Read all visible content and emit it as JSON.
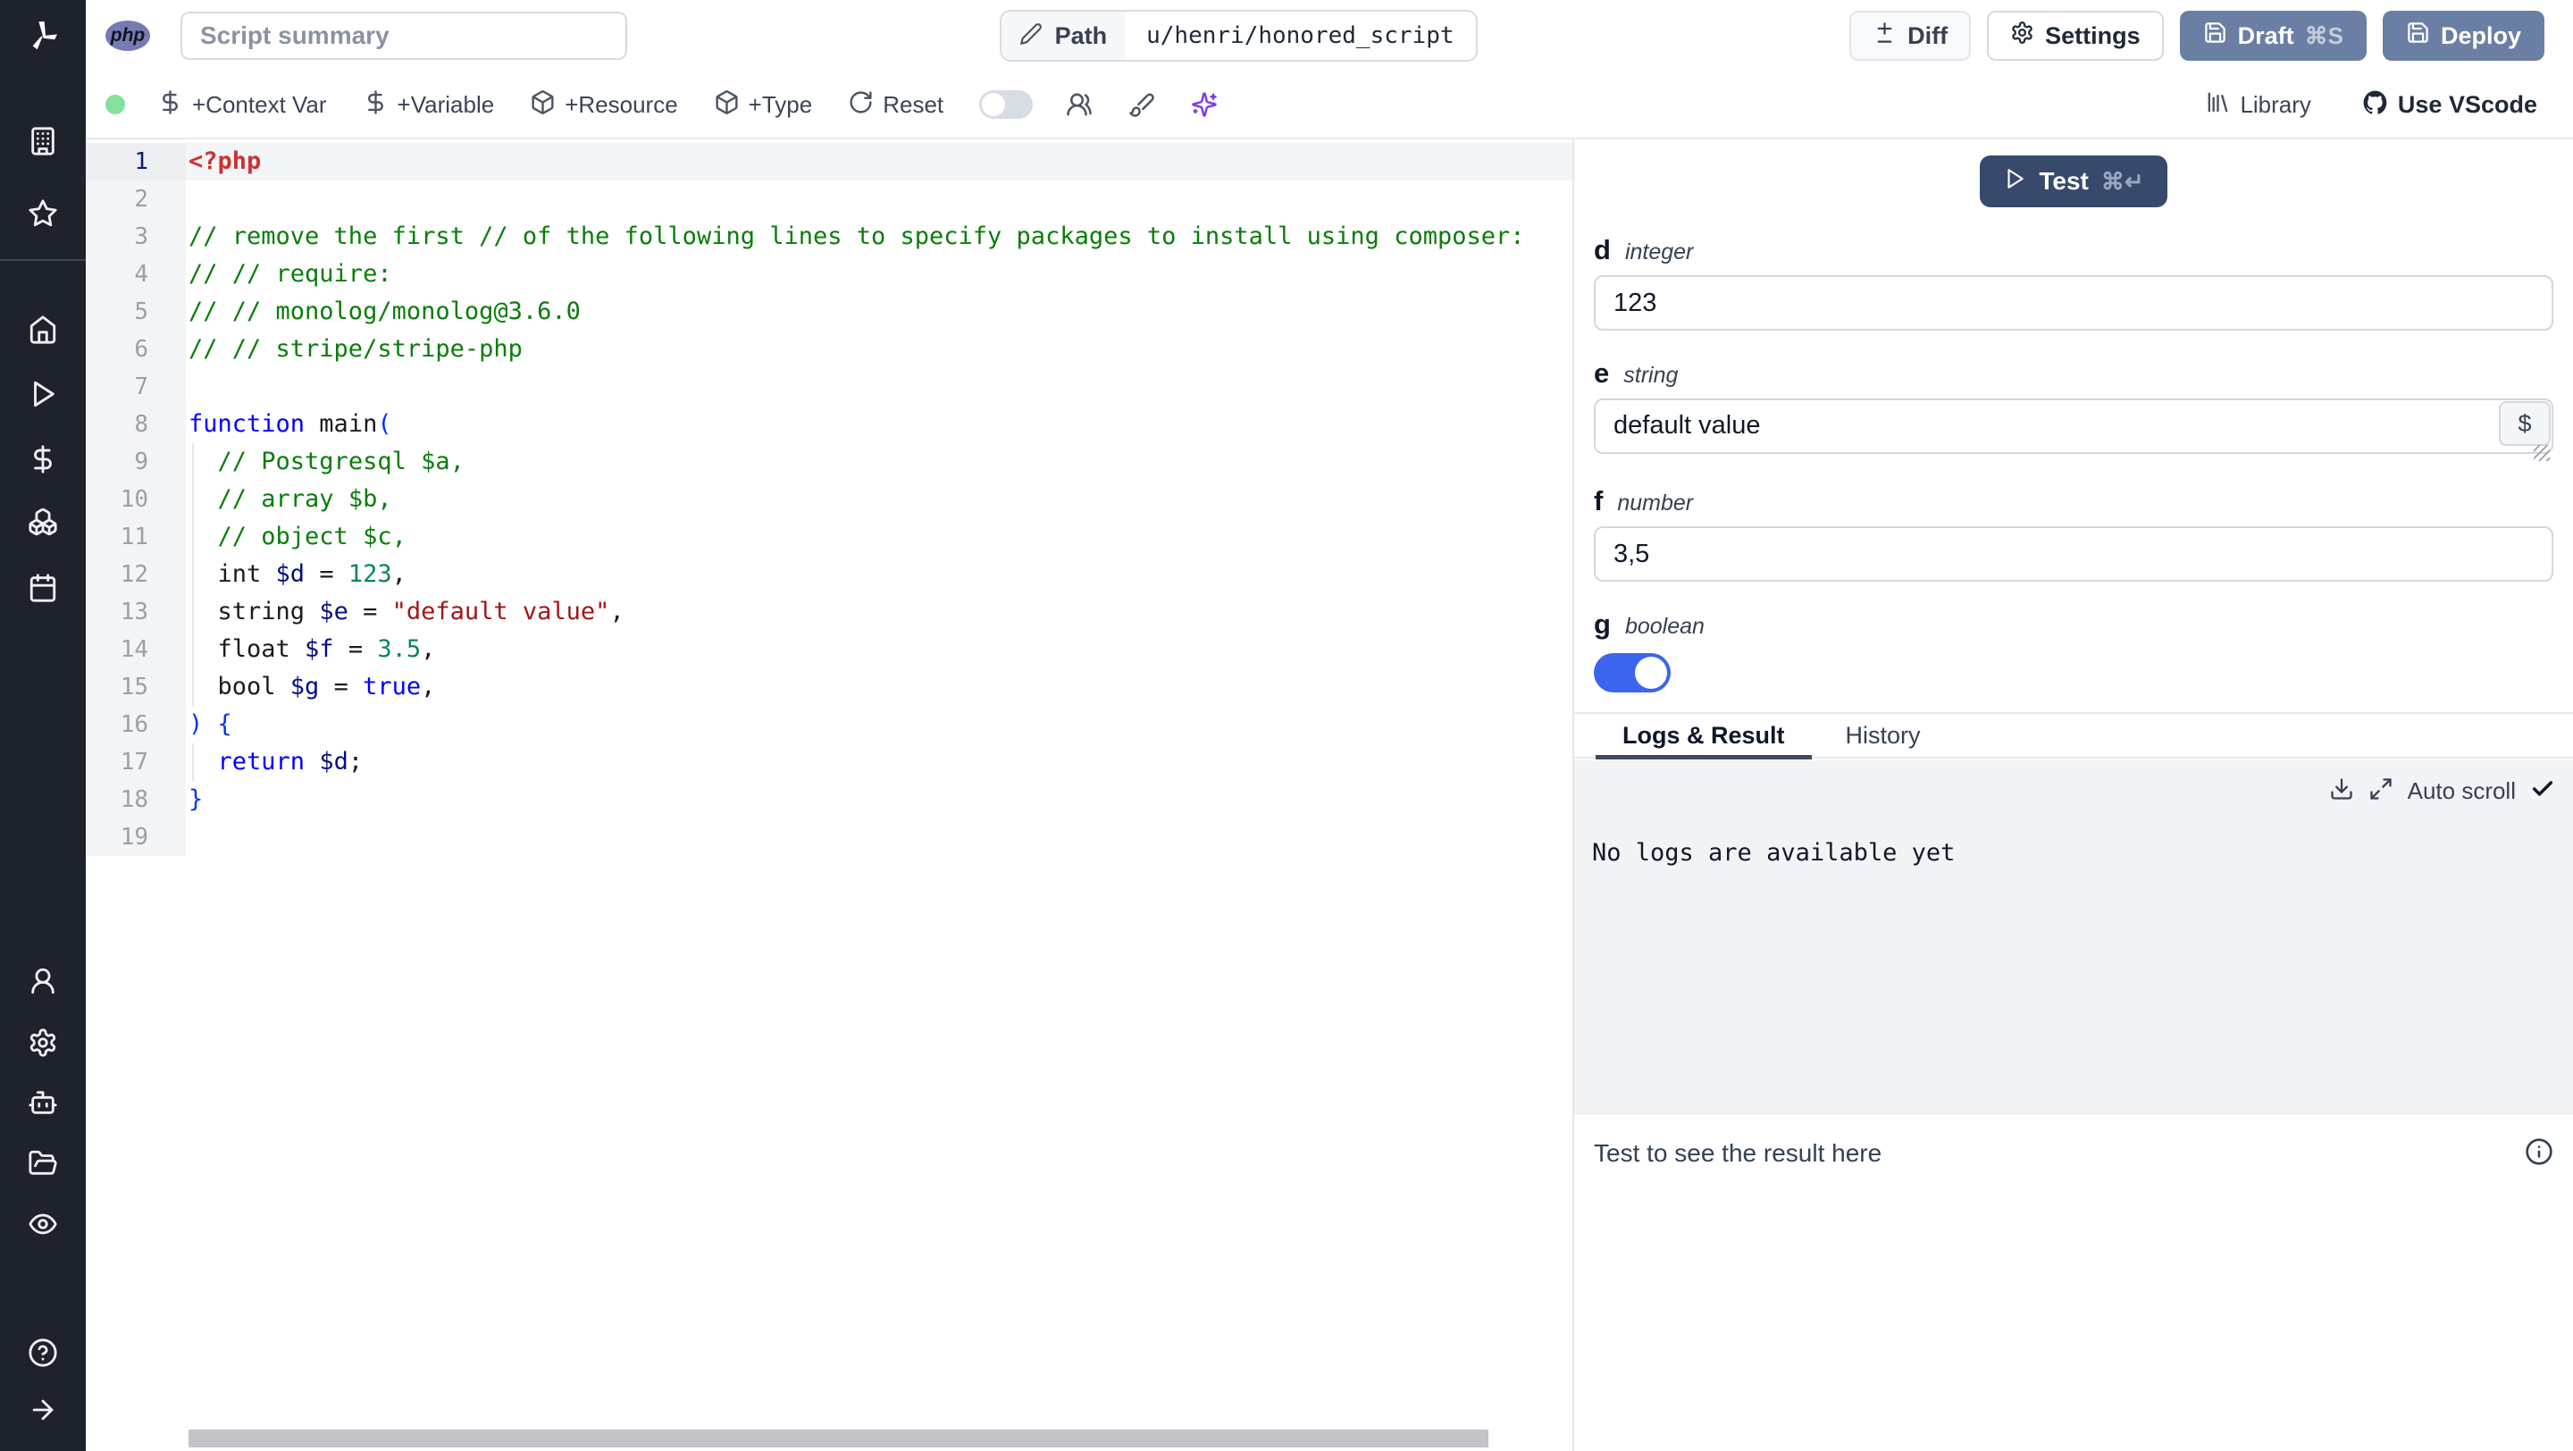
{
  "colors": {
    "sidebar_bg": "#1d222d",
    "primary_button": "#6b7fa4",
    "test_button": "#384a6b",
    "toggle_on": "#3c64ee",
    "php_badge": "#777bb3",
    "green_status_dot": "#84e19c",
    "sparkles_accent": "#7c3aed",
    "code_comment": "#0a7d0a",
    "code_keyword": "#0000ff",
    "code_variable": "#001080",
    "code_number": "#098658",
    "code_string": "#a31515",
    "code_tag": "#cd3131"
  },
  "header": {
    "lang_badge": "php",
    "summary_placeholder": "Script summary",
    "path_label": "Path",
    "path_value": "u/henri/honored_script",
    "diff_label": "Diff",
    "settings_label": "Settings",
    "draft_label": "Draft",
    "draft_shortcut": "⌘S",
    "deploy_label": "Deploy"
  },
  "toolbar": {
    "add_context_var": "+Context Var",
    "add_variable": "+Variable",
    "add_resource": "+Resource",
    "add_type": "+Type",
    "reset": "Reset",
    "library": "Library",
    "use_vscode": "Use VScode"
  },
  "editor": {
    "language": "php",
    "lines": [
      {
        "n": 1,
        "current": true,
        "toks": [
          [
            "tag",
            "<?php"
          ]
        ]
      },
      {
        "n": 2,
        "toks": []
      },
      {
        "n": 3,
        "toks": [
          [
            "com",
            "// remove the first // of the following lines to specify packages to install using composer:"
          ]
        ]
      },
      {
        "n": 4,
        "toks": [
          [
            "com",
            "// // require:"
          ]
        ]
      },
      {
        "n": 5,
        "toks": [
          [
            "com",
            "// // monolog/monolog@3.6.0"
          ]
        ]
      },
      {
        "n": 6,
        "toks": [
          [
            "com",
            "// // stripe/stripe-php"
          ]
        ]
      },
      {
        "n": 7,
        "toks": []
      },
      {
        "n": 8,
        "toks": [
          [
            "kw",
            "function"
          ],
          [
            "pl",
            " main"
          ],
          [
            "br",
            "("
          ]
        ]
      },
      {
        "n": 9,
        "toks": [
          [
            "pl",
            "  "
          ],
          [
            "com",
            "// Postgresql $a,"
          ]
        ]
      },
      {
        "n": 10,
        "toks": [
          [
            "pl",
            "  "
          ],
          [
            "com",
            "// array $b,"
          ]
        ]
      },
      {
        "n": 11,
        "toks": [
          [
            "pl",
            "  "
          ],
          [
            "com",
            "// object $c,"
          ]
        ]
      },
      {
        "n": 12,
        "toks": [
          [
            "pl",
            "  int "
          ],
          [
            "var",
            "$d"
          ],
          [
            "pl",
            " = "
          ],
          [
            "num",
            "123"
          ],
          [
            "pl",
            ","
          ]
        ]
      },
      {
        "n": 13,
        "toks": [
          [
            "pl",
            "  string "
          ],
          [
            "var",
            "$e"
          ],
          [
            "pl",
            " = "
          ],
          [
            "str",
            "\"default value\""
          ],
          [
            "pl",
            ","
          ]
        ]
      },
      {
        "n": 14,
        "toks": [
          [
            "pl",
            "  float "
          ],
          [
            "var",
            "$f"
          ],
          [
            "pl",
            " = "
          ],
          [
            "num",
            "3.5"
          ],
          [
            "pl",
            ","
          ]
        ]
      },
      {
        "n": 15,
        "toks": [
          [
            "pl",
            "  bool "
          ],
          [
            "var",
            "$g"
          ],
          [
            "pl",
            " = "
          ],
          [
            "kw",
            "true"
          ],
          [
            "pl",
            ","
          ]
        ]
      },
      {
        "n": 16,
        "toks": [
          [
            "br",
            ") {"
          ]
        ]
      },
      {
        "n": 17,
        "toks": [
          [
            "pl",
            "  "
          ],
          [
            "kw",
            "return"
          ],
          [
            "pl",
            " "
          ],
          [
            "var",
            "$d"
          ],
          [
            "pl",
            ";"
          ]
        ]
      },
      {
        "n": 18,
        "toks": [
          [
            "br",
            "}"
          ]
        ]
      },
      {
        "n": 19,
        "toks": []
      }
    ]
  },
  "right_panel": {
    "test_label": "Test",
    "test_shortcut": "⌘↵",
    "fields": [
      {
        "name": "d",
        "type": "integer",
        "value": "123"
      },
      {
        "name": "e",
        "type": "string",
        "value": "default value",
        "button": "$"
      },
      {
        "name": "f",
        "type": "number",
        "value": "3,5"
      },
      {
        "name": "g",
        "type": "boolean",
        "value": "true"
      }
    ],
    "tabs": {
      "logs": "Logs & Result",
      "history": "History"
    },
    "auto_scroll_label": "Auto scroll",
    "no_logs_message": "No logs are available yet",
    "result_placeholder": "Test to see the result here"
  }
}
